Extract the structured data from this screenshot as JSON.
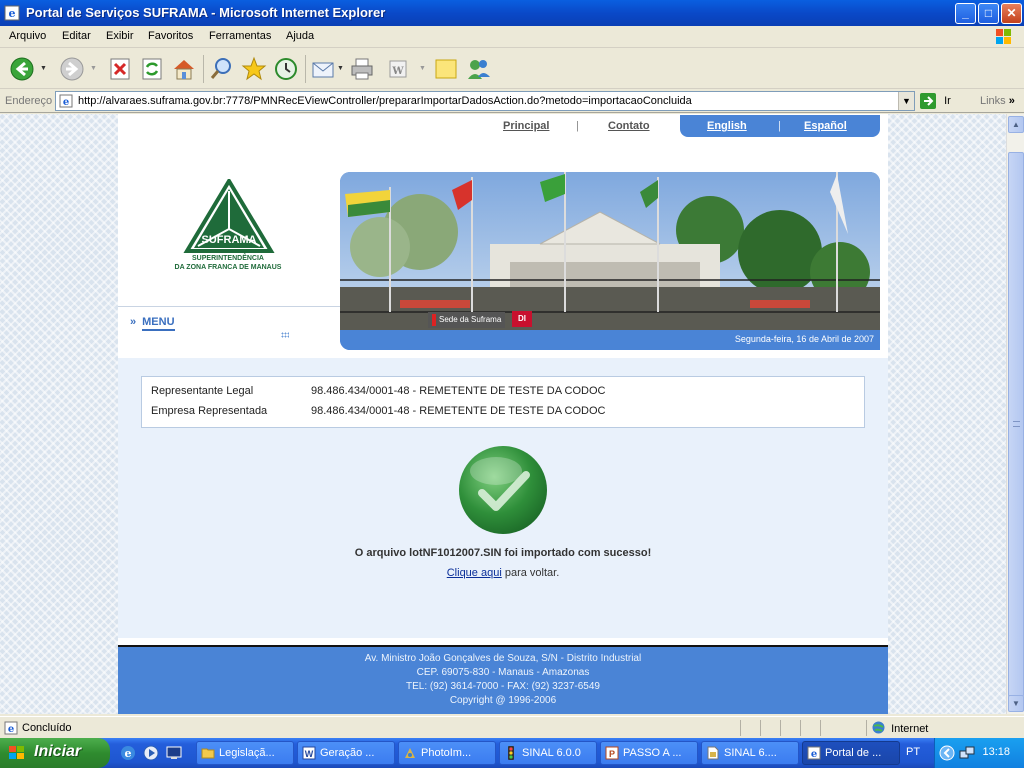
{
  "window": {
    "title": "Portal de Serviços SUFRAMA - Microsoft Internet Explorer",
    "minimize": "_",
    "maximize": "□",
    "close": "✕"
  },
  "menubar": [
    "Arquivo",
    "Editar",
    "Exibir",
    "Favoritos",
    "Ferramentas",
    "Ajuda"
  ],
  "address": {
    "label": "Endereço",
    "url": "http://alvaraes.suframa.gov.br:7778/PMNRecEViewController/prepararImportarDadosAction.do?metodo=importacaoConcluida",
    "go_label": "Ir",
    "links_label": "Links"
  },
  "site": {
    "nav": {
      "principal": "Principal",
      "contato": "Contato",
      "english": "English",
      "espanol": "Español",
      "separator": "|"
    },
    "logo": {
      "wordmark": "SUFRAMA",
      "subtitle_line1": "SUPERINTENDÊNCIA",
      "subtitle_line2": "DA ZONA FRANCA DE MANAUS"
    },
    "menu_label": "MENU",
    "banner": {
      "caption": "Sede da Suframa",
      "badge": "DI",
      "date": "Segunda-feira, 16 de Abril de 2007"
    },
    "info": {
      "rows": [
        {
          "label": "Representante Legal",
          "value": "98.486.434/0001-48 - REMETENTE DE TESTE DA CODOC"
        },
        {
          "label": "Empresa Representada",
          "value": "98.486.434/0001-48 - REMETENTE DE TESTE DA CODOC"
        }
      ]
    },
    "success_message": "O arquivo lotNF1012007.SIN foi importado com sucesso!",
    "back_link": "Clique aqui",
    "back_suffix": " para voltar.",
    "footer": [
      "Av. Ministro João Gonçalves de Souza, S/N - Distrito Industrial",
      "CEP. 69075-830 - Manaus - Amazonas",
      "TEL: (92) 3614-7000 - FAX: (92) 3237-6549",
      "Copyright @ 1996-2006"
    ]
  },
  "status": {
    "text": "Concluído",
    "zone": "Internet"
  },
  "taskbar": {
    "start": "Iniciar",
    "tasks": [
      {
        "label": "Legislaçã...",
        "icon": "folder-icon",
        "active": false
      },
      {
        "label": "Geração ...",
        "icon": "word-icon",
        "active": false
      },
      {
        "label": "PhotoIm...",
        "icon": "photo-icon",
        "active": false
      },
      {
        "label": "SINAL 6.0.0",
        "icon": "traffic-light-icon",
        "active": false
      },
      {
        "label": "PASSO A ...",
        "icon": "powerpoint-icon",
        "active": false
      },
      {
        "label": "SINAL 6....",
        "icon": "document-icon",
        "active": false
      },
      {
        "label": "Portal de ...",
        "icon": "ie-icon",
        "active": true
      }
    ],
    "language": "PT",
    "clock": "13:18"
  },
  "colors": {
    "accent_blue": "#4a84d6",
    "suframa_green": "#1f6b3a"
  }
}
